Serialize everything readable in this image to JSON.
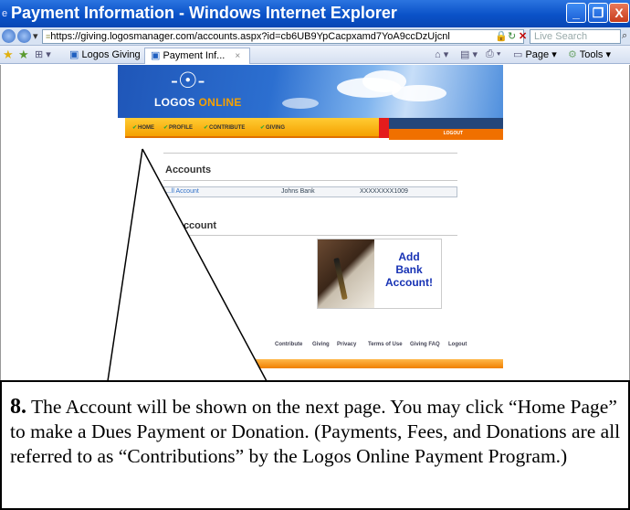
{
  "window": {
    "title": "Payment Information - Windows Internet Explorer",
    "minimize": "_",
    "maximize": "❐",
    "close": "X"
  },
  "address_bar": {
    "url": "https://giving.logosmanager.com/accounts.aspx?id=cb6UB9YpCacpxamd7YoA9ccDzUjcnl",
    "search_placeholder": "Live Search"
  },
  "tabs": [
    {
      "label": "Logos Giving"
    },
    {
      "label": "Payment Inf...",
      "close": "×"
    }
  ],
  "commands": {
    "page": "Page ▾",
    "tools": "Tools ▾"
  },
  "site": {
    "logo_text_a": "LOGOS ",
    "logo_text_b": "ONLINE",
    "nav": [
      {
        "label": "HOME"
      },
      {
        "label": "PROFILE"
      },
      {
        "label": "CONTRIBUTE"
      },
      {
        "label": "GIVING"
      }
    ],
    "logout": "LOGOUT",
    "accounts_heading": "Accounts",
    "account_row": {
      "type": "...ll Account",
      "bank": "Johns Bank",
      "number": "XXXXXXXX1009"
    },
    "add_account_heading": "Account",
    "add_bank_text": [
      "Add",
      "Bank",
      "Account!"
    ],
    "footer_links": [
      "...e",
      "Contribute",
      "Giving",
      "Privacy",
      "Terms of Use",
      "Giving FAQ",
      "Logout"
    ]
  },
  "callout": {
    "step_number": "8.",
    "text": " The Account will be shown on the next page.  You may click “Home Page” to make a Dues Payment or Donation. (Payments, Fees, and Donations are all referred to as “Contributions” by the Logos Online Payment Program.)"
  }
}
